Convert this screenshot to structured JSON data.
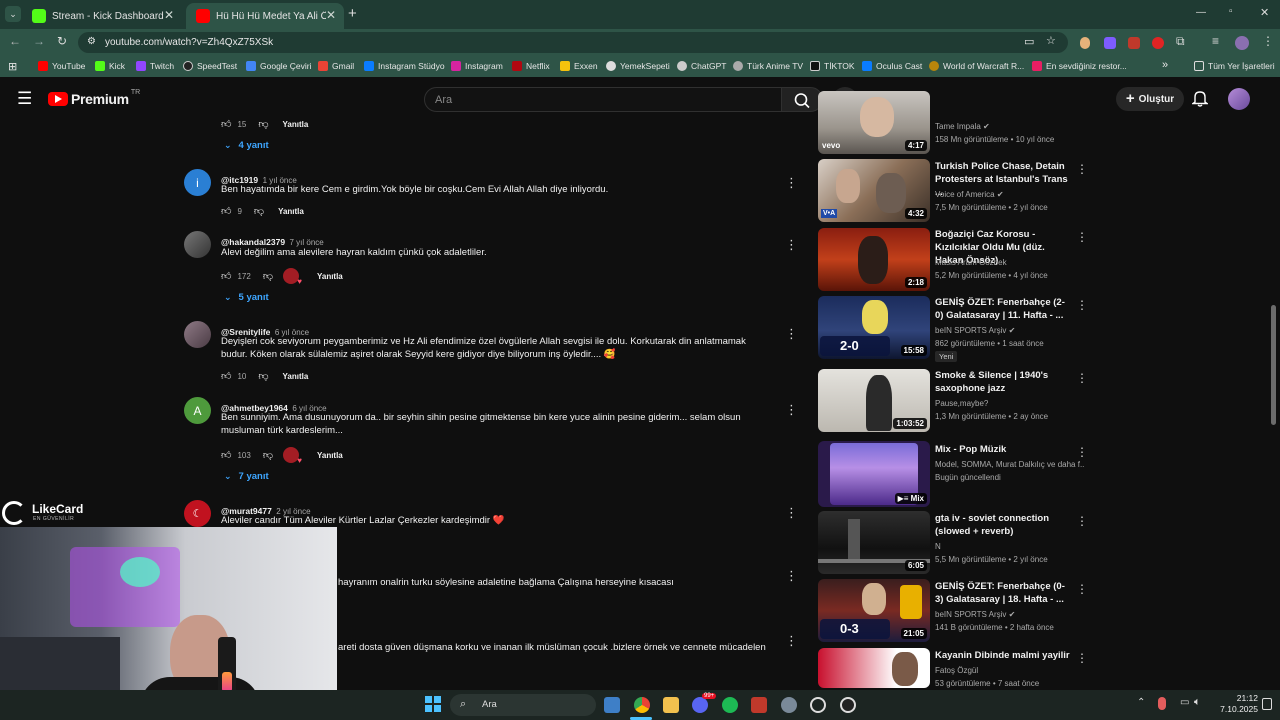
{
  "browser": {
    "tabs": [
      {
        "title": "Stream - Kick Dashboard",
        "active": false
      },
      {
        "title": "Hü Hü Hü Medet Ya Ali Özlem",
        "active": true
      }
    ],
    "url": "youtube.com/watch?v=Zh4QxZ75XSk",
    "bookmarks": [
      "YouTube",
      "Kick",
      "Twitch",
      "SpeedTest",
      "Google Çeviri",
      "Gmail",
      "Instagram Stüdyo",
      "Instagram",
      "Netflix",
      "Exxen",
      "YemekSepeti",
      "ChatGPT",
      "Türk Anime TV",
      "TİKTOK",
      "Oculus Cast",
      "World of Warcraft R...",
      "En sevdiğiniz restor..."
    ],
    "all_bookmarks": "Tüm Yer İşaretleri"
  },
  "youtube": {
    "logo_text": "Premium",
    "logo_sup": "TR",
    "search_placeholder": "Ara",
    "create_label": "Oluştur"
  },
  "comments": {
    "top_like": "15",
    "top_reply": "Yanıtla",
    "top_replies": "4 yanıt",
    "items": [
      {
        "handle": "@itc1919",
        "time": "1 yıl önce",
        "text": "Ben hayatımda bir kere Cem e girdim.Yok böyle bir coşku.Cem Evi Allah Allah diye inliyordu.",
        "likes": "9",
        "reply": "Yanıtla",
        "avatar_letter": "i",
        "avatar_color": "#2a7fd4"
      },
      {
        "handle": "@hakandal2379",
        "time": "7 yıl önce",
        "text": "Alevi değilim ama alevilere hayran kaldım çünkü çok adaletliler.",
        "likes": "172",
        "reply": "Yanıtla",
        "replies": "5 yanıt"
      },
      {
        "handle": "@Srenitylife",
        "time": "6 yıl önce",
        "text": "Deyişleri cok seviyorum peygamberimiz ve Hz Ali efendimize özel övgülerle Allah sevgisi ile dolu.  Korkutarak din anlatmamak budur.  Köken olarak sülalemiz aşiret olarak Seyyid kere gidiyor diye biliyorum inş öyledir.... 🥰",
        "likes": "10",
        "reply": "Yanıtla"
      },
      {
        "handle": "@ahmetbey1964",
        "time": "6 yıl önce",
        "text": "Ben sunniyim. Ama dusunuyorum da.. bir seyhin sihin pesine gitmektense bin kere yuce alinin pesine giderim... selam olsun musluman türk kardeslerim...",
        "likes": "103",
        "reply": "Yanıtla",
        "replies": "7 yanıt",
        "avatar_letter": "A",
        "avatar_color": "#4e9a3c"
      },
      {
        "handle": "@murat9477",
        "time": "2 yıl önce",
        "text": "Aleviler candır Tüm Aleviler Kürtler Lazlar Çerkezler kardeşimdir ❤️"
      },
      {
        "text": "hayranım onalrin turku söylesine adaletine bağlama Çalışına herseyine kısacası"
      },
      {
        "text": "areti dosta güven düşmana korku ve inanan ilk müslüman çocuk .bizlere örnek ve cennete mücadelen"
      }
    ]
  },
  "recommendations": [
    {
      "title": "",
      "channel": "Tame Impala",
      "meta": "158 Mn görüntüleme • 10 yıl önce",
      "duration": "4:17",
      "verified": true
    },
    {
      "title": "Turkish Police Chase, Detain Protesters at Istanbul's Trans ...",
      "channel": "Voice of America",
      "meta": "7,5 Mn görüntüleme • 2 yıl önce",
      "duration": "4:32",
      "verified": true
    },
    {
      "title": "Boğaziçi Caz Korosu - Kızılcıklar Oldu Mu (düz. Hakan Önsöz)",
      "channel": "Masis Aram Gözbek",
      "meta": "5,2 Mn görüntüleme • 4 yıl önce",
      "duration": "2:18"
    },
    {
      "title": "GENİŞ ÖZET: Fenerbahçe (2-0) Galatasaray | 11. Hafta - ...",
      "channel": "beIN SPORTS Arşiv",
      "meta": "862 görüntüleme • 1 saat önce",
      "duration": "15:58",
      "verified": true,
      "badge": "Yeni",
      "score": "2-0"
    },
    {
      "title": "Smoke & Silence    |    1940's saxophone jazz",
      "channel": "Pause,maybe?",
      "meta": "1,3 Mn görüntüleme • 2 ay önce",
      "duration": "1:03:52"
    },
    {
      "title": "Mix - Pop Müzik",
      "channel": "Model, SOMMA, Murat Dalkılıç ve daha f...",
      "meta": "Bugün güncellendi",
      "duration": "Mix"
    },
    {
      "title": "gta iv - soviet connection (slowed + reverb)",
      "channel": "N",
      "meta": "5,5 Mn görüntüleme • 2 yıl önce",
      "duration": "6:05"
    },
    {
      "title": "GENİŞ ÖZET: Fenerbahçe (0-3) Galatasaray | 18. Hafta - ...",
      "channel": "beIN SPORTS Arşiv",
      "meta": "141 B görüntüleme • 2 hafta önce",
      "duration": "21:05",
      "verified": true,
      "score": "0-3"
    },
    {
      "title": "Kayanin   Dibinde malmi yayilir",
      "channel": "Fatoş Özgül",
      "meta": "53 görüntüleme • 7 saat önce",
      "duration": ""
    }
  ],
  "overlay": {
    "brand": "LikeCard",
    "brand_sub": "EN GÜVENİLİR"
  },
  "taskbar": {
    "search": "Ara",
    "time": "21:12",
    "date": "7.10.2025",
    "badge": "99+"
  }
}
